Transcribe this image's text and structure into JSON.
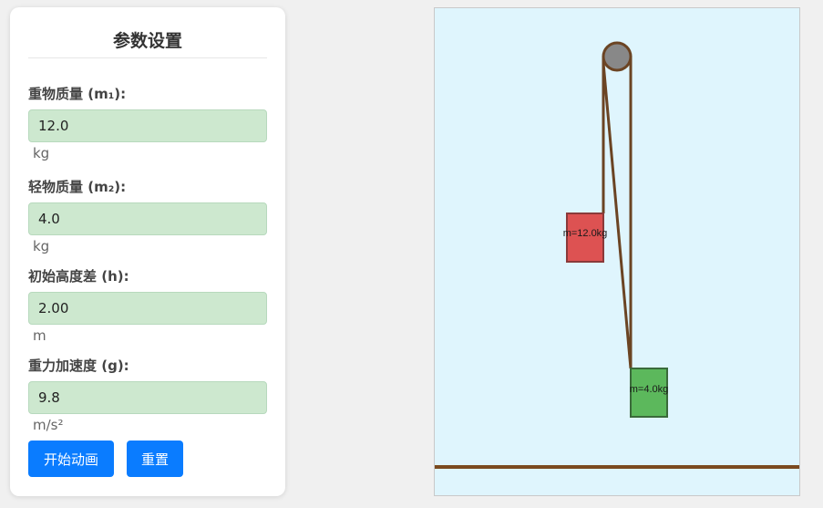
{
  "panel": {
    "title": "参数设置",
    "fields": {
      "m1": {
        "label": "重物质量 (m₁):",
        "value": "12.0",
        "unit": "kg"
      },
      "m2": {
        "label": "轻物质量 (m₂):",
        "value": "4.0",
        "unit": "kg"
      },
      "h": {
        "label": "初始高度差 (h):",
        "value": "2.00",
        "unit": "m"
      },
      "g": {
        "label": "重力加速度 (g):",
        "value": "9.8",
        "unit": "m/s²"
      }
    },
    "buttons": {
      "start": "开始动画",
      "reset": "重置"
    }
  },
  "scene": {
    "heavy_label": "m=12.0kg",
    "light_label": "m=4.0kg",
    "colors": {
      "background": "#dff5fd",
      "pulley": "#888888",
      "rope": "#6b4423",
      "ground": "#7a4a1f",
      "heavy_block": "#dd5252",
      "light_block": "#5cb85c"
    }
  }
}
